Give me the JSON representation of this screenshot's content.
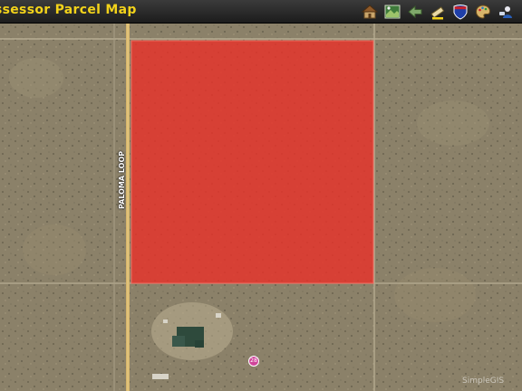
{
  "toolbar": {
    "title": "ssessor Parcel Map",
    "title_color": "#f2d21a",
    "tools": [
      {
        "name": "house-icon",
        "label": ""
      },
      {
        "name": "aerial-photo-icon",
        "label": ""
      },
      {
        "name": "back-arrow-icon",
        "label": ""
      },
      {
        "name": "edit-pencil-icon",
        "label": ""
      },
      {
        "name": "interstate-shield-icon",
        "label": ""
      },
      {
        "name": "palette-icon",
        "label": ""
      },
      {
        "name": "user-icon",
        "label": ""
      }
    ]
  },
  "map": {
    "road_label": "PALOMA LOOP",
    "road_label_small": "oda",
    "parcel_color": "#e8322a",
    "watermark": "SimpleGIS",
    "marker_label": "28"
  }
}
